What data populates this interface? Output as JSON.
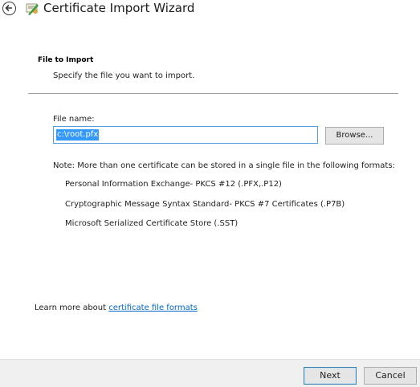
{
  "window": {
    "title": "Certificate Import Wizard"
  },
  "section": {
    "title": "File to Import",
    "subtitle": "Specify the file you want to import."
  },
  "file": {
    "label": "File name:",
    "value": "c:\\root.pfx",
    "browse_label": "Browse..."
  },
  "note": {
    "text": "Note:  More than one certificate can be stored in a single file in the following formats:",
    "formats": [
      "Personal Information Exchange- PKCS #12 (.PFX,.P12)",
      "Cryptographic Message Syntax Standard- PKCS #7 Certificates (.P7B)",
      "Microsoft Serialized Certificate Store (.SST)"
    ]
  },
  "learn_more": {
    "prefix": "Learn more about ",
    "link": "certificate file formats"
  },
  "footer": {
    "next_label": "Next",
    "cancel_label": "Cancel"
  },
  "colors": {
    "link": "#0066cc",
    "selection": "#3399ff",
    "focus_border": "#569de5"
  },
  "icons": {
    "back": "back-arrow-icon",
    "title": "certificate-icon"
  }
}
